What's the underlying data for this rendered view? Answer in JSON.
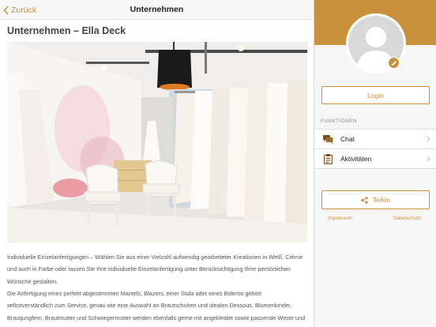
{
  "navbar": {
    "back_label": "Zurück",
    "title": "Unternehmen"
  },
  "content": {
    "title": "Unternehmen – Ella Deck",
    "paragraph_1": "Individuelle Einzelanfertigungen – Wählen Sie aus einer Vielzahl aufwendig gearbeiteter Kreationen in Weiß, Crème und auch in Farbe oder lassen Sie Ihre individuelle Einzelanfertigung unter Berücksichtigung Ihrer persönlichen Wünsche gestalten.",
    "paragraph_2": "Die Anfertigung eines perfekt abgestimmten Mantels, Blazers, einer Stola oder eines Boleros gehört selbstverständlich zum Service, genau wie eine Auswahl an Brautschuhen und idealen Dessous. Blumenkinder, Brautjungfern, Brautmutter und Schwiegermutter werden ebenfalls gerne mit angekleidet sowie passende Weste und Plastron für den Bräutigam gefertigt."
  },
  "sidebar": {
    "login_label": "Login",
    "section_label": "FUNKTIONEN",
    "menu": [
      {
        "label": "Chat",
        "icon": "chat-icon"
      },
      {
        "label": "Aktivitäten",
        "icon": "clipboard-icon"
      }
    ],
    "share_label": "Teilen",
    "impressum_label": "Impressum",
    "datenschutz_label": "Datenschutz"
  },
  "colors": {
    "accent": "#c8913a",
    "nav_accent": "#c7913d",
    "sidebar_bg": "#f6f6f6"
  }
}
